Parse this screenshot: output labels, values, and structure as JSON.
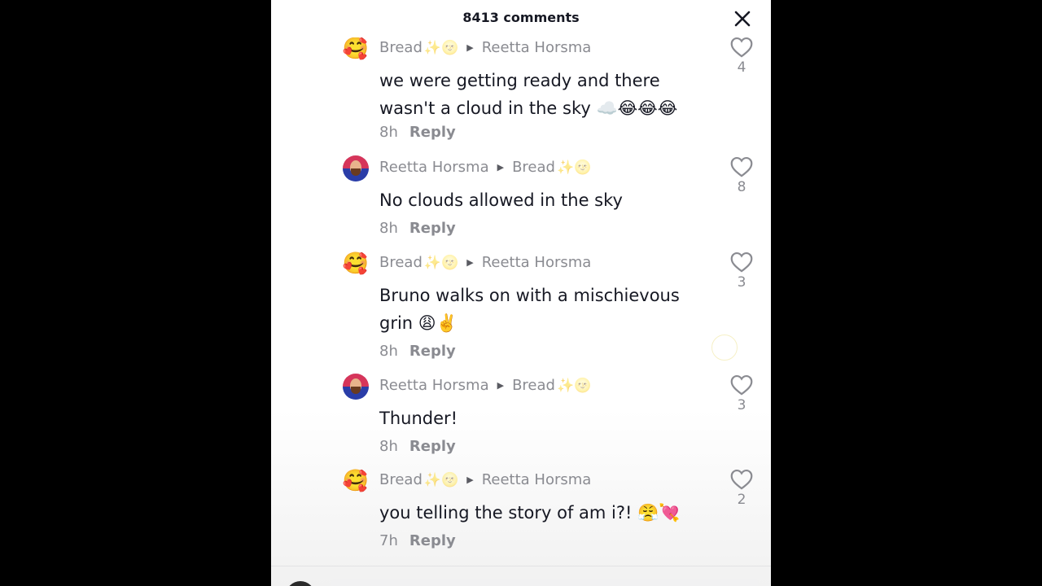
{
  "header": {
    "title": "8413 comments",
    "close_icon": "close-icon"
  },
  "comments": [
    {
      "author": "Bread",
      "author_deco": "✨🌝",
      "reply_to": "Reetta Horsma",
      "reply_to_deco": "",
      "avatar": "emoji-face-avatar",
      "text": "we were getting ready and there wasn't a cloud in the sky ☁️😂😂😂",
      "time": "8h",
      "reply_label": "Reply",
      "likes": "4"
    },
    {
      "author": "Reetta Horsma",
      "author_deco": "",
      "reply_to": "Bread",
      "reply_to_deco": "✨🌝",
      "avatar": "photo-avatar",
      "text": "No clouds allowed in the sky",
      "time": "8h",
      "reply_label": "Reply",
      "likes": "8"
    },
    {
      "author": "Bread",
      "author_deco": "✨🌝",
      "reply_to": "Reetta Horsma",
      "reply_to_deco": "",
      "avatar": "emoji-face-avatar",
      "text": "Bruno walks on with a mischievous grin 😩✌️",
      "time": "8h",
      "reply_label": "Reply",
      "likes": "3"
    },
    {
      "author": "Reetta Horsma",
      "author_deco": "",
      "reply_to": "Bread",
      "reply_to_deco": "✨🌝",
      "avatar": "photo-avatar",
      "text": "Thunder!",
      "time": "8h",
      "reply_label": "Reply",
      "likes": "3"
    },
    {
      "author": "Bread",
      "author_deco": "✨🌝",
      "reply_to": "Reetta Horsma",
      "reply_to_deco": "",
      "avatar": "emoji-face-avatar",
      "text": "you telling the story of am i?! 😤💘",
      "time": "7h",
      "reply_label": "Reply",
      "likes": "2"
    }
  ],
  "emoji_avatar_glyph": "🥰",
  "heart_icon": "heart-icon",
  "colors": {
    "muted": "#8a8b91",
    "text": "#161823",
    "backdrop": "#000000"
  }
}
